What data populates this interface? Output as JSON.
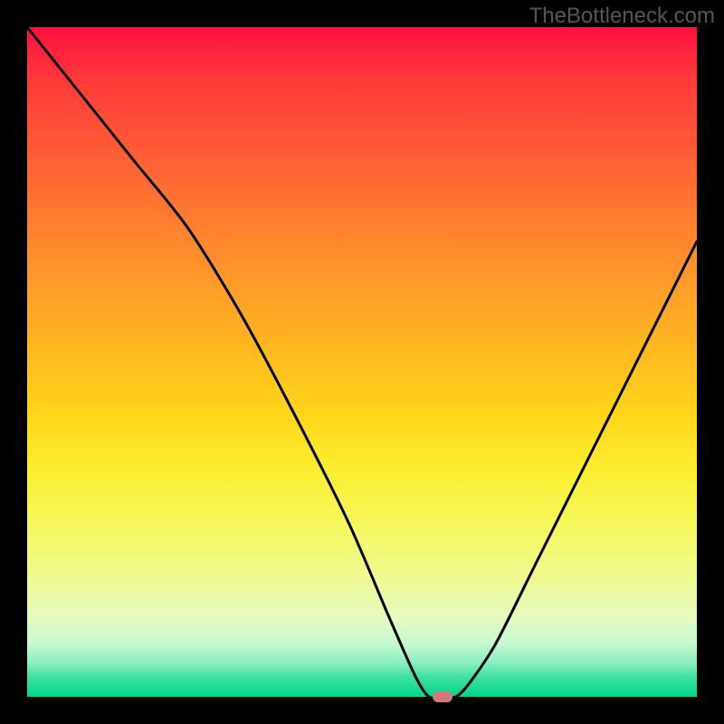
{
  "attribution": "TheBottleneck.com",
  "chart_data": {
    "type": "line",
    "title": "",
    "xlabel": "",
    "ylabel": "",
    "xlim": [
      0,
      100
    ],
    "ylim": [
      0,
      100
    ],
    "grid": false,
    "legend": false,
    "series": [
      {
        "name": "bottleneck-curve",
        "x": [
          0,
          8,
          16,
          24,
          32,
          40,
          48,
          54,
          58,
          60,
          62,
          64,
          66,
          70,
          76,
          84,
          92,
          100
        ],
        "y": [
          100,
          90,
          80,
          70,
          57,
          42,
          26,
          12,
          3,
          0,
          0,
          0,
          2,
          8,
          20,
          36,
          52,
          68
        ]
      }
    ],
    "marker": {
      "x": 62,
      "y": 0,
      "color": "#d47a7a"
    },
    "gradient_stops": [
      {
        "pct": 0,
        "color": "#ff1040"
      },
      {
        "pct": 50,
        "color": "#ffd000"
      },
      {
        "pct": 90,
        "color": "#f0fa90"
      },
      {
        "pct": 100,
        "color": "#00d88a"
      }
    ]
  }
}
